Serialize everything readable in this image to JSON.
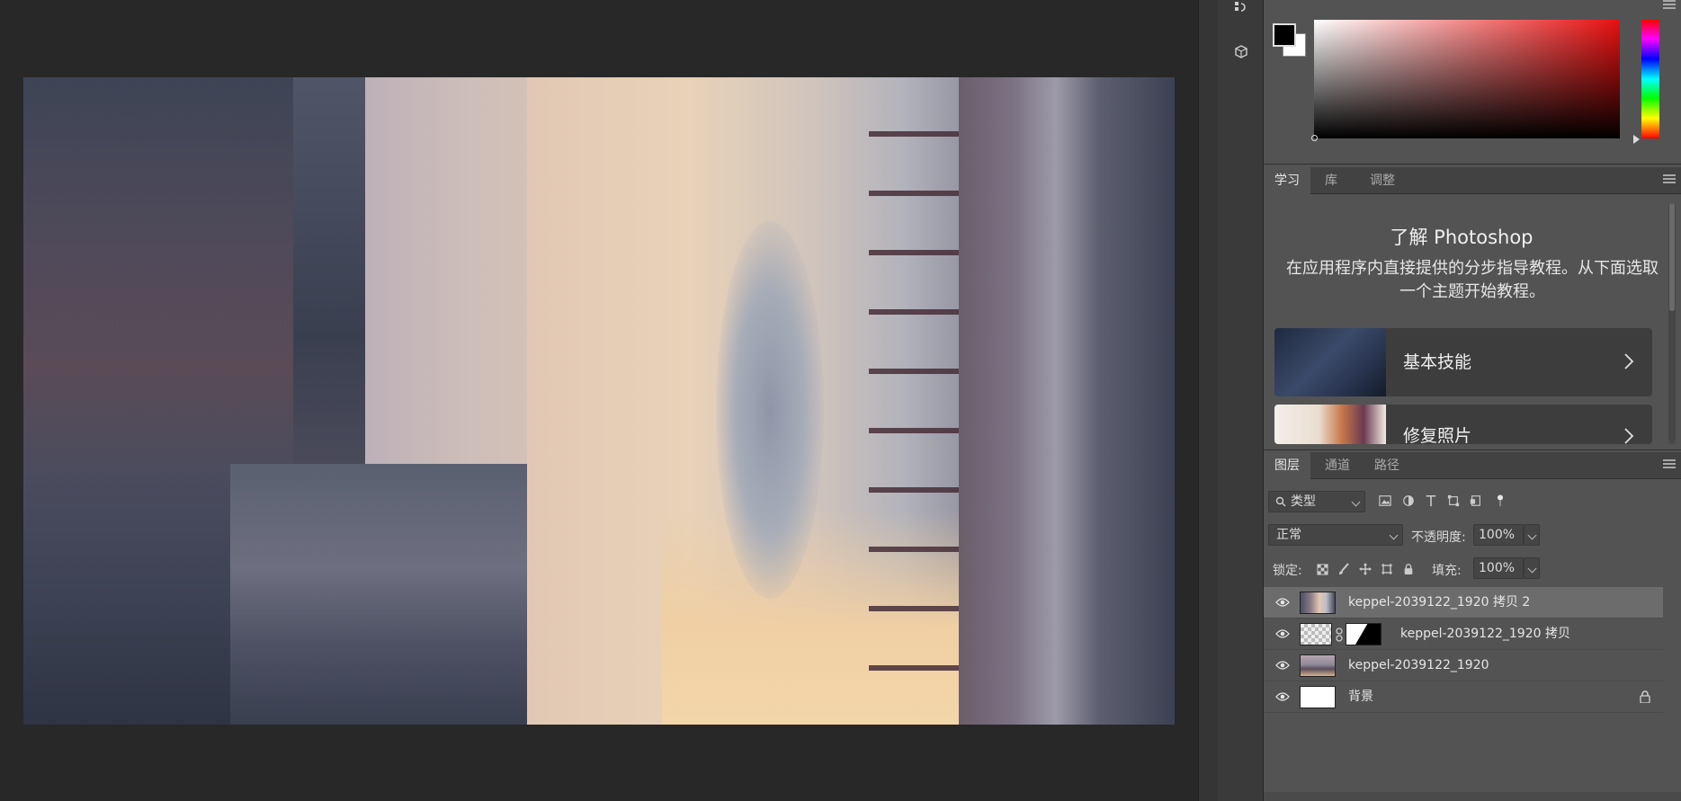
{
  "document": {
    "image_name": "keppel-2039122_1920"
  },
  "color_panel": {
    "foreground": "#000000",
    "background": "#ffffff"
  },
  "learn_panel": {
    "tabs": [
      {
        "label": "学习"
      },
      {
        "label": "库"
      },
      {
        "label": "调整"
      }
    ],
    "title": "了解 Photoshop",
    "description": "在应用程序内直接提供的分步指导教程。从下面选取一个主题开始教程。",
    "cards": [
      {
        "label": "基本技能"
      },
      {
        "label": "修复照片"
      }
    ]
  },
  "layers_panel": {
    "tabs": [
      {
        "label": "图层"
      },
      {
        "label": "通道"
      },
      {
        "label": "路径"
      }
    ],
    "filter_label": "类型",
    "blend_mode": "正常",
    "opacity_label": "不透明度:",
    "opacity_value": "100%",
    "lock_label": "锁定:",
    "fill_label": "填充:",
    "fill_value": "100%",
    "layers": [
      {
        "name": "keppel-2039122_1920 拷贝 2",
        "selected": true
      },
      {
        "name": "keppel-2039122_1920 拷贝",
        "selected": false,
        "has_mask": true
      },
      {
        "name": "keppel-2039122_1920",
        "selected": false
      },
      {
        "name": "背景",
        "selected": false,
        "locked": true
      }
    ]
  },
  "accent_colors": {
    "selected_layer": "#6c6c6c",
    "panel_bg": "#535353",
    "canvas_bg": "#282828"
  }
}
